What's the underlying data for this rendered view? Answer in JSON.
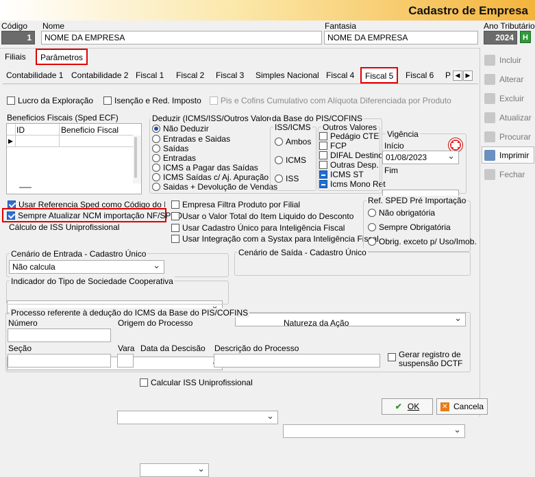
{
  "window_title": "Cadastro de Empresa",
  "header": {
    "codigo_label": "Código",
    "codigo_value": "1",
    "nome_label": "Nome",
    "nome_value": "NOME DA EMPRESA",
    "fantasia_label": "Fantasia",
    "fantasia_value": "NOME DA EMPRESA",
    "ano_label": "Ano Tributário",
    "ano_value": "2024",
    "ano_button": "H"
  },
  "top_tabs": [
    "Filiais",
    "Parâmetros"
  ],
  "sub_tabs": [
    "Contabilidade 1",
    "Contabilidade 2",
    "Fiscal 1",
    "Fiscal 2",
    "Fiscal 3",
    "Simples Nacional",
    "Fiscal 4",
    "Fiscal 5",
    "Fiscal 6",
    "P"
  ],
  "checks_top": {
    "lucro": "Lucro da Exploração",
    "isencao": "Isenção e Red. Imposto",
    "pis_cofins": "Pis e Cofins Cumulativo com Alíquota Diferenciada por Produto"
  },
  "beneficios": {
    "title": "Beneficios Fiscais (Sped ECF)",
    "col_id": "ID",
    "col_beneficio": "Beneficio Fiscal"
  },
  "deduzir": {
    "title": "Deduzir (ICMS/ISS/Outros Valores)",
    "title2": "da Base do PIS/COFINS",
    "options": [
      "Não Deduzir",
      "Entradas e Saidas",
      "Saídas",
      "Entradas",
      "ICMS a Pagar das Saídas",
      "ICMS Saídas c/ Aj. Apuração",
      "Saidas +  Devolução de Vendas"
    ],
    "iss_title": "ISS/ICMS",
    "iss_options": [
      "Ambos",
      "ICMS",
      "ISS"
    ],
    "outros_title": "Outros Valores",
    "outros_options": [
      "Pedágio CTE",
      "FCP",
      "DIFAL Destino",
      "Outras Desp.",
      "ICMS ST",
      "Icms Mono Ret"
    ]
  },
  "vigencia": {
    "title": "Vigência",
    "inicio_label": "Início",
    "inicio_value": "01/08/2023",
    "fim_label": "Fim",
    "fim_value": ""
  },
  "checks_mid": {
    "usar_ref": "Usar Referencia Sped como Código do Item",
    "sempre_ncm": "Sempre Atualizar NCM importação NF/SPED",
    "empresa_filtra": "Empresa Filtra Produto por Filial",
    "usar_valor": "Usar o Valor Total do Item Liquido do Desconto",
    "cadastro_unico": "Usar Cadastro Único para Inteligência Fiscal",
    "systax": "Usar Integração com a Systax para Inteligência Fiscal"
  },
  "iss_uni": {
    "label": "Cálculo de ISS Uniprofissional",
    "value": "Não calcula"
  },
  "ref_sped": {
    "title": "Ref. SPED Pré Importação",
    "options": [
      "Não obrigatória",
      "Sempre Obrigatória",
      "Obrig. exceto p/ Uso/Imob."
    ]
  },
  "cenario_entrada": {
    "title": "Cenário de Entrada - Cadastro Único",
    "value": ""
  },
  "cenario_saida": {
    "title": "Cenário de Saída - Cadastro Único",
    "value": ""
  },
  "indicador": {
    "title": "Indicador do Tipo de Sociedade Cooperativa",
    "value": ""
  },
  "processo": {
    "title": "Processo referente à dedução do ICMS da Base do PIS/COFINS",
    "numero": "Número",
    "origem": "Origem do Processo",
    "natureza": "Natureza da Ação",
    "secao": "Seção",
    "vara": "Vara",
    "data": "Data da Descisão",
    "descricao": "Descrição do Processo",
    "gerar1": "Gerar registro de",
    "gerar2": "suspensão DCTF"
  },
  "calcular_iss": "Calcular ISS Uniprofissional",
  "side_buttons": [
    "Incluir",
    "Alterar",
    "Excluir",
    "Atualizar",
    "Procurar",
    "Imprimir",
    "Fechar"
  ],
  "ok_label": "OK",
  "cancel_label": "Cancela"
}
